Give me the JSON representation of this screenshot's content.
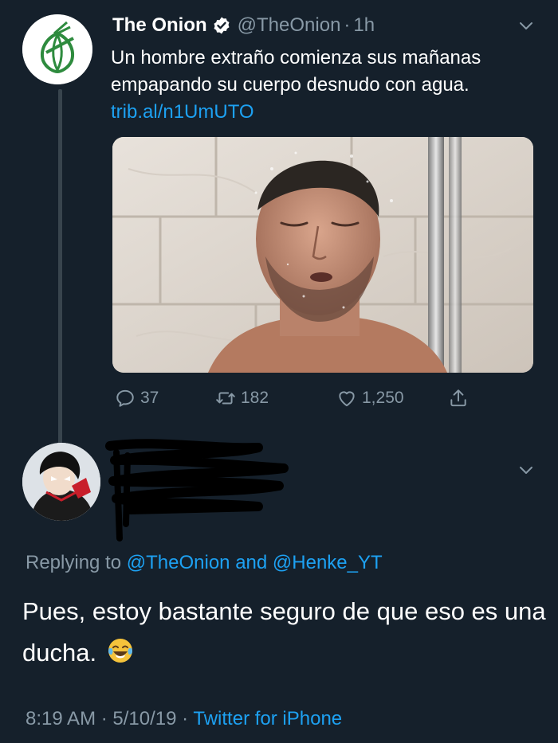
{
  "tweet": {
    "name": "The Onion",
    "handle": "@TheOnion",
    "separator": "·",
    "time": "1h",
    "text": "Un hombre extraño comienza sus mañanas empapando su cuerpo desnudo con agua.",
    "link": "trib.al/n1UmUTO",
    "actions": {
      "replies": "37",
      "retweets": "182",
      "likes": "1,250"
    }
  },
  "reply": {
    "replying_prefix": "Replying to",
    "mention_1": "@TheOnion",
    "and_word": "and",
    "mention_2": "@Henke_YT",
    "text": "Pues, estoy bastante seguro de que eso es una ducha.",
    "emoji": "face-with-tears-of-joy",
    "time": "8:19 AM",
    "separator": "·",
    "date": "5/10/19",
    "source": "Twitter for iPhone"
  },
  "colors": {
    "background": "#15202b",
    "secondary_text": "#8899a6",
    "link": "#1da1f2",
    "onion_green": "#2e8b3e"
  }
}
